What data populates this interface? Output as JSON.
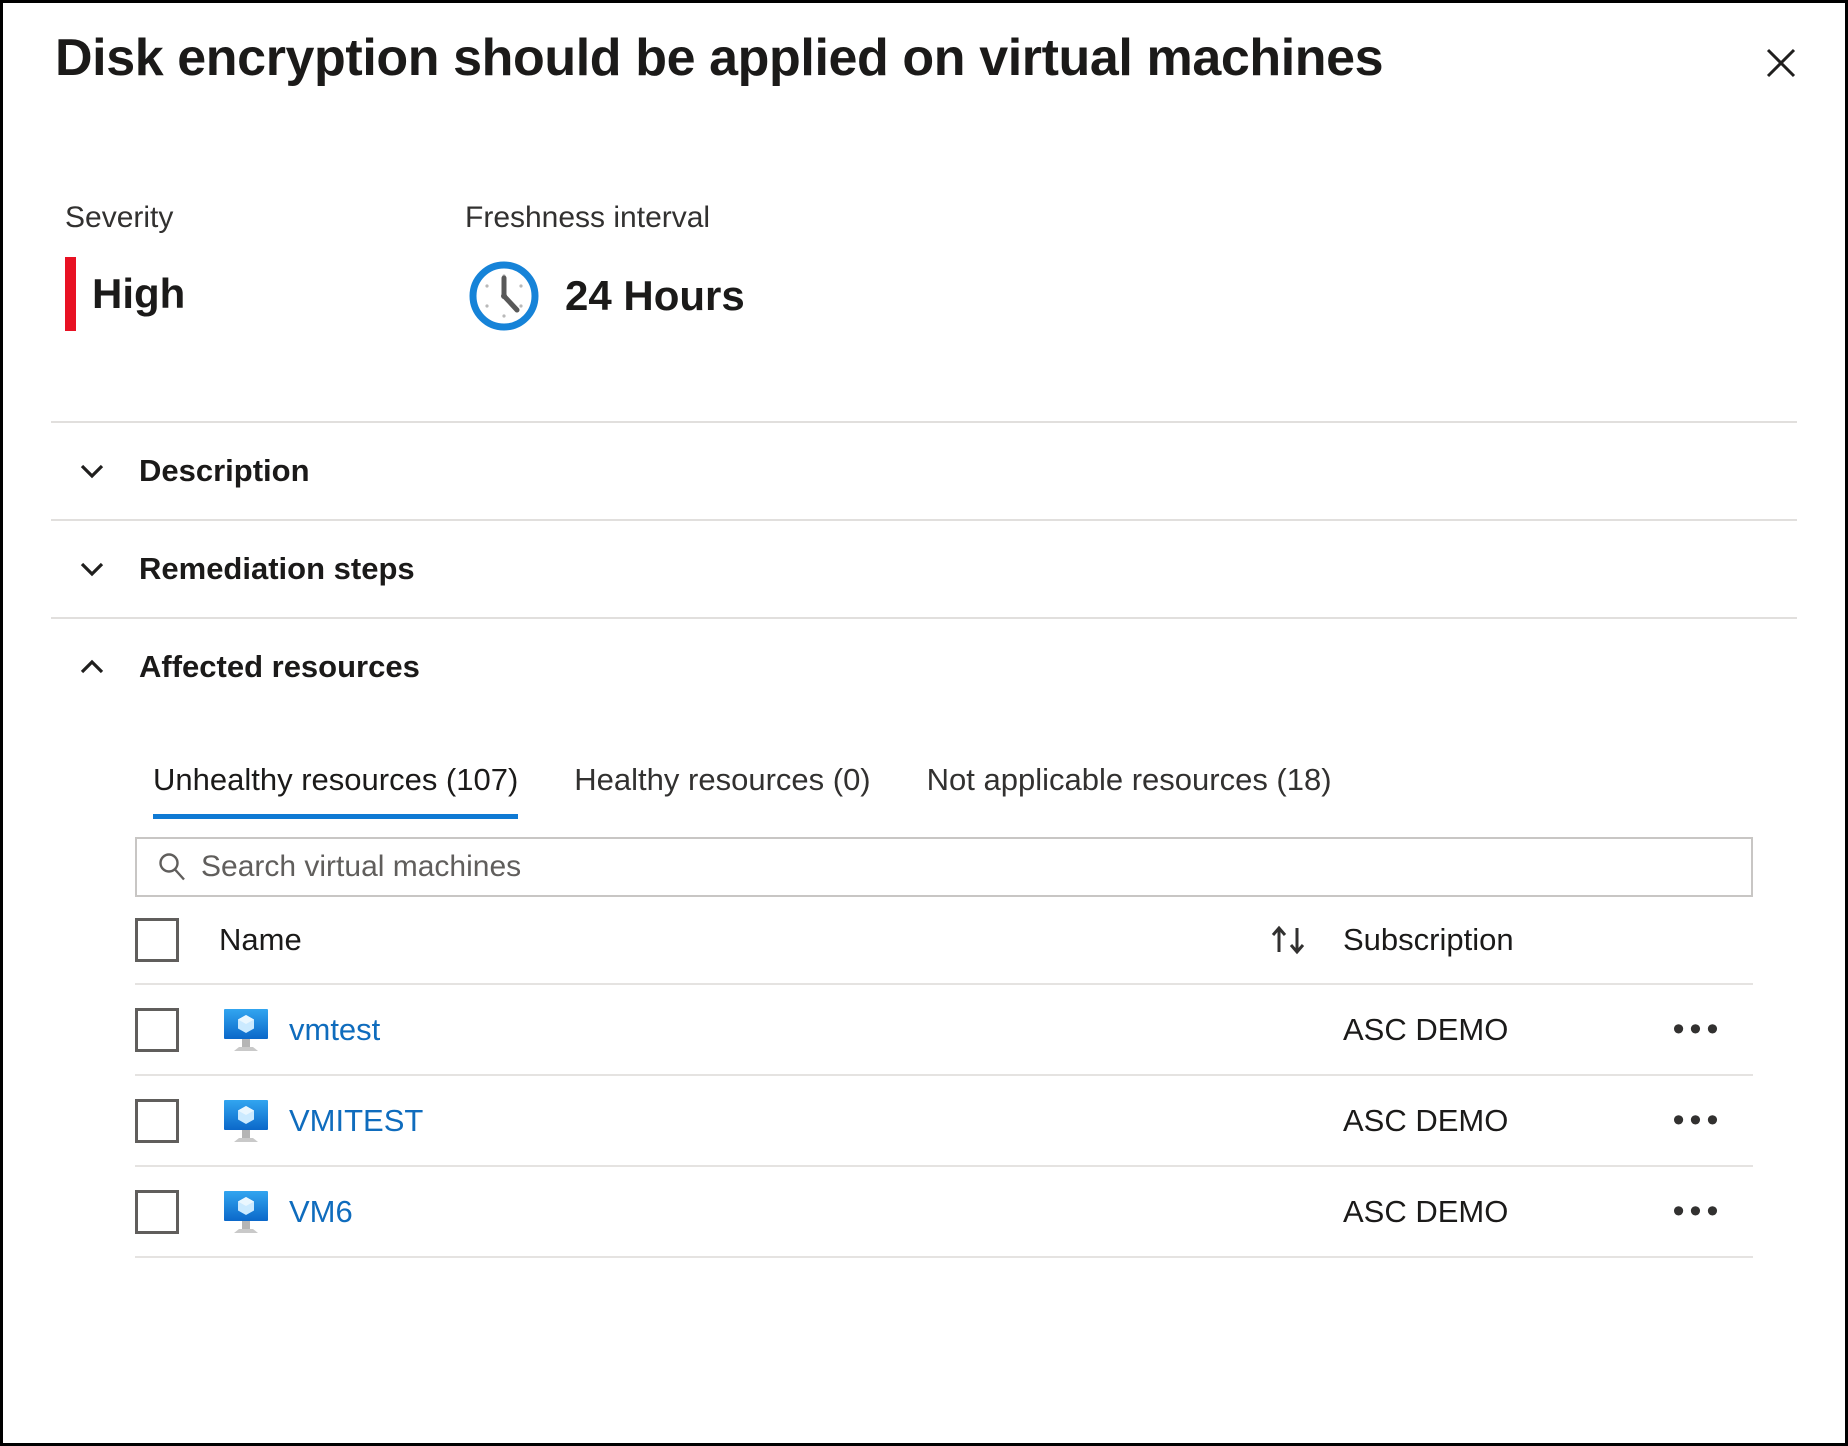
{
  "header": {
    "title": "Disk encryption should be applied on virtual machines",
    "close_label": "✕"
  },
  "meta": {
    "severity_label": "Severity",
    "severity_value": "High",
    "severity_color": "#e81123",
    "freshness_label": "Freshness interval",
    "freshness_value": "24 Hours"
  },
  "sections": [
    {
      "title": "Description",
      "expanded": false
    },
    {
      "title": "Remediation steps",
      "expanded": false
    },
    {
      "title": "Affected resources",
      "expanded": true
    }
  ],
  "tabs": [
    {
      "label": "Unhealthy resources (107)",
      "active": true
    },
    {
      "label": "Healthy resources (0)",
      "active": false
    },
    {
      "label": "Not applicable resources (18)",
      "active": false
    }
  ],
  "search": {
    "placeholder": "Search virtual machines",
    "value": ""
  },
  "table": {
    "columns": {
      "name": "Name",
      "subscription": "Subscription"
    },
    "rows": [
      {
        "name": "vmtest",
        "subscription": "ASC DEMO",
        "more": "•••"
      },
      {
        "name": "VMITEST",
        "subscription": "ASC DEMO",
        "more": "•••"
      },
      {
        "name": "VM6",
        "subscription": "ASC DEMO",
        "more": "•••"
      }
    ]
  },
  "colors": {
    "accent": "#0f7ad4",
    "link": "#0f6cbd",
    "severity_high": "#e81123"
  }
}
